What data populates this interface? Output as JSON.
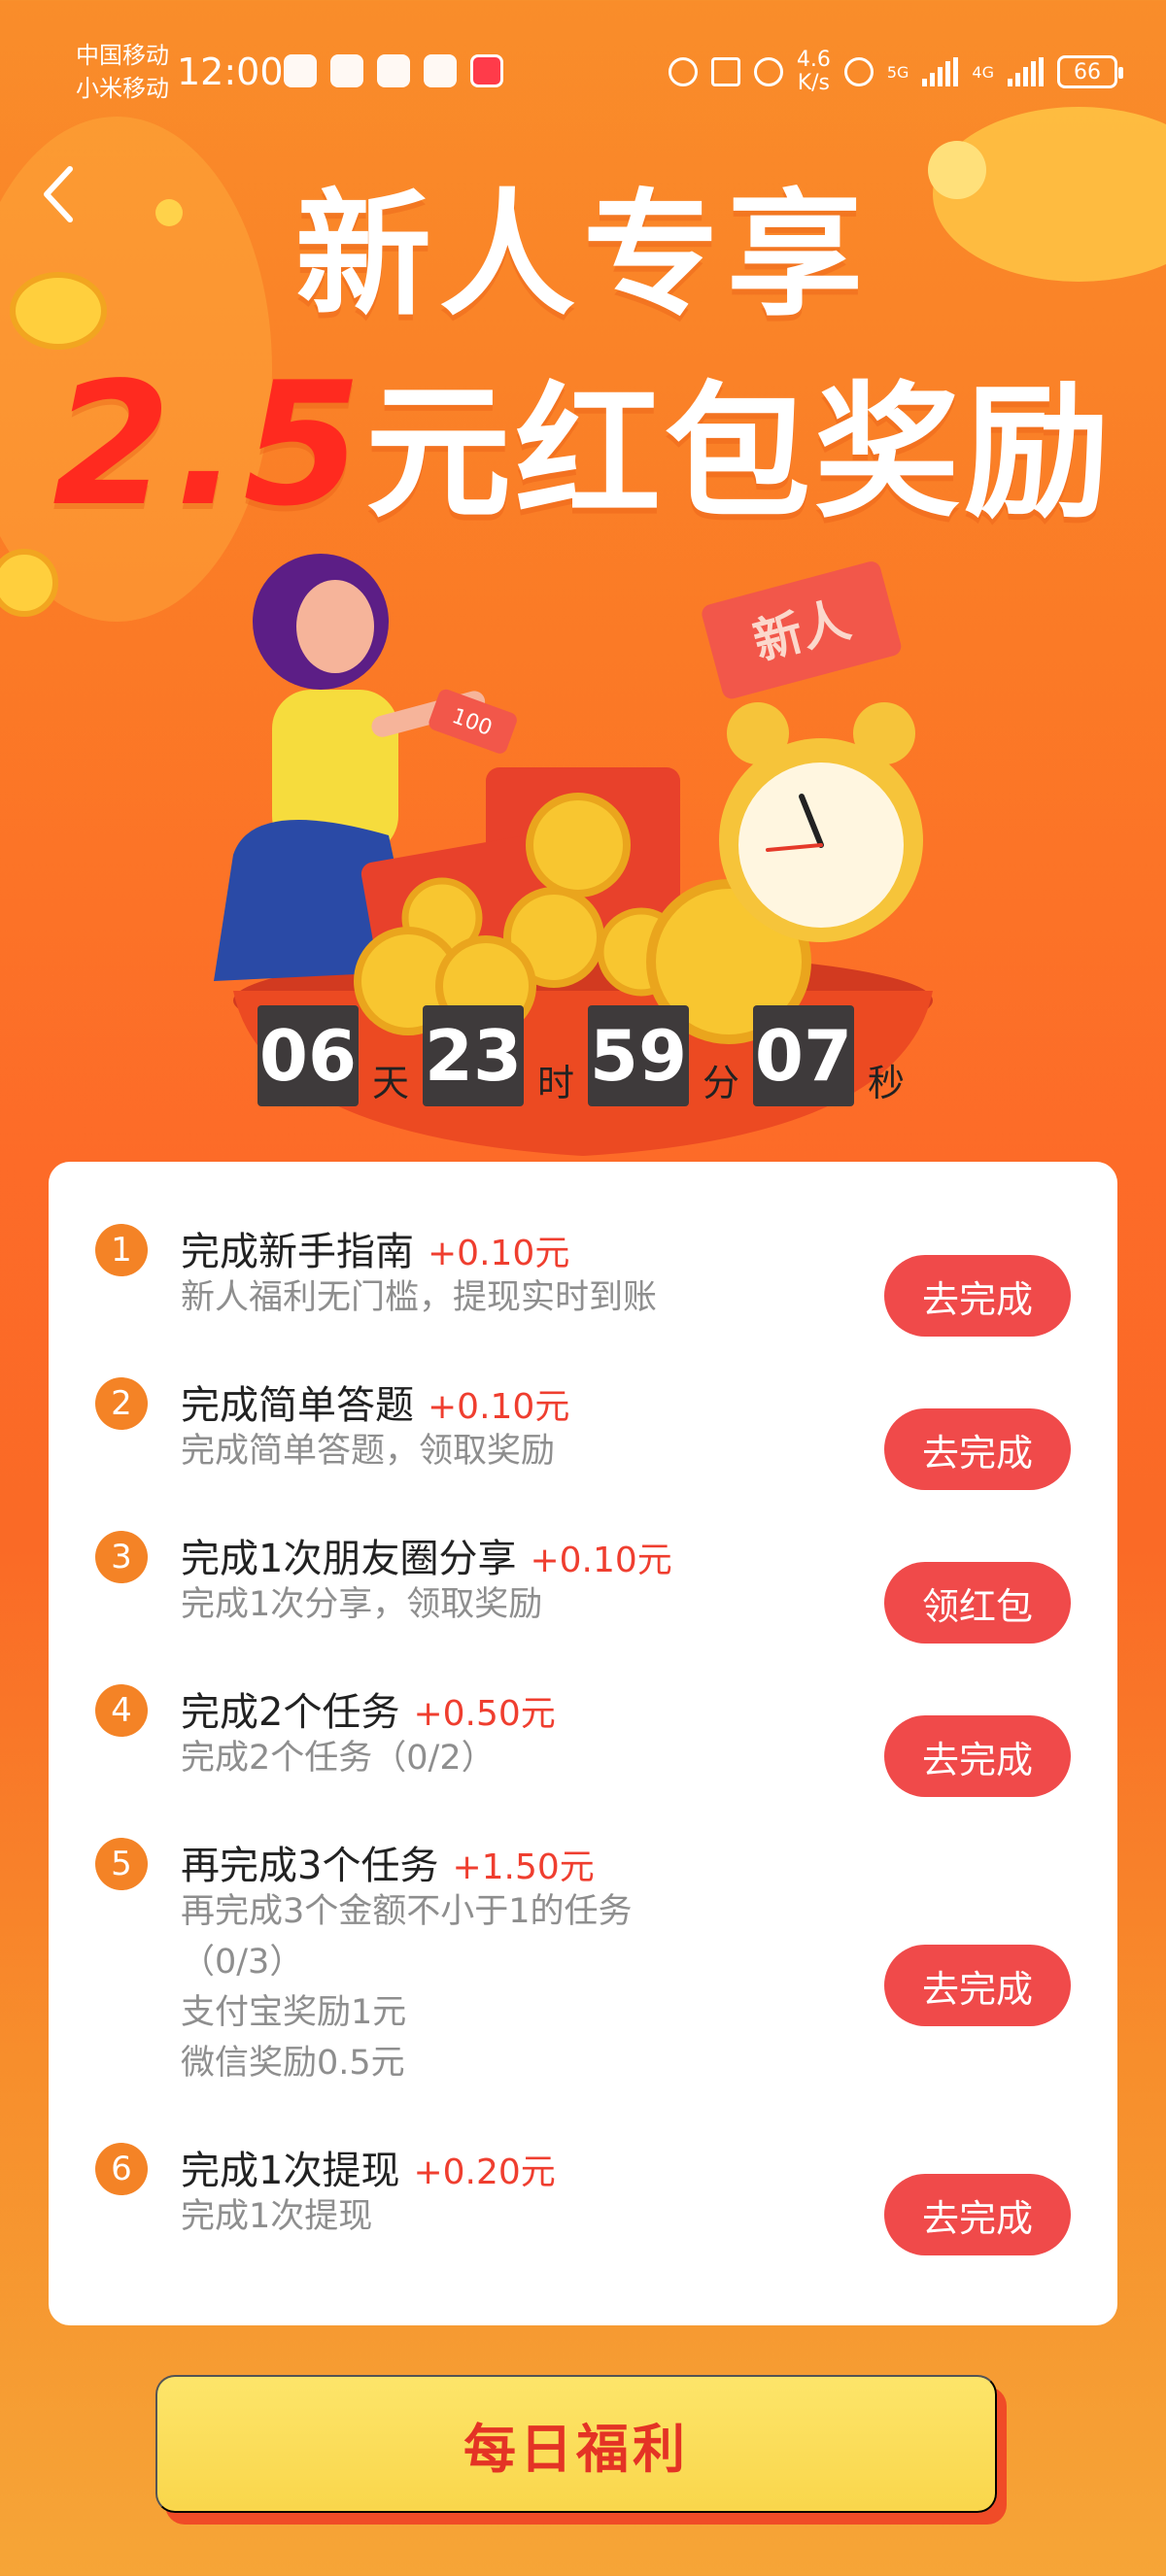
{
  "status_bar": {
    "carrier1": "中国移动",
    "carrier2": "小米移动",
    "time": "12:00",
    "speed_value": "4.6",
    "speed_unit": "K/s",
    "net1": "5G",
    "net2": "4G",
    "battery": "66"
  },
  "header": {
    "title_line1": "新人专享",
    "amount": "2.5",
    "title_line2_suffix": "元红包奖励",
    "illustration_badge": "新人",
    "illustration_note": "100"
  },
  "countdown": {
    "days": "06",
    "days_unit": "天",
    "hours": "23",
    "hours_unit": "时",
    "minutes": "59",
    "minutes_unit": "分",
    "seconds": "07",
    "seconds_unit": "秒"
  },
  "tasks": [
    {
      "num": "1",
      "title": "完成新手指南",
      "reward": "+0.10元",
      "desc": [
        "新人福利无门槛，提现实时到账"
      ],
      "button": "去完成"
    },
    {
      "num": "2",
      "title": "完成简单答题",
      "reward": "+0.10元",
      "desc": [
        "完成简单答题，领取奖励"
      ],
      "button": "去完成"
    },
    {
      "num": "3",
      "title": "完成1次朋友圈分享",
      "reward": "+0.10元",
      "desc": [
        "完成1次分享，领取奖励"
      ],
      "button": "领红包"
    },
    {
      "num": "4",
      "title": "完成2个任务",
      "reward": "+0.50元",
      "desc": [
        "完成2个任务（0/2）"
      ],
      "button": "去完成"
    },
    {
      "num": "5",
      "title": "再完成3个任务",
      "reward": "+1.50元",
      "desc": [
        "再完成3个金额不小于1的任务",
        "（0/3）",
        "支付宝奖励1元",
        "微信奖励0.5元"
      ],
      "button": "去完成"
    },
    {
      "num": "6",
      "title": "完成1次提现",
      "reward": "+0.20元",
      "desc": [
        "完成1次提现"
      ],
      "button": "去完成"
    }
  ],
  "footer": {
    "daily_button": "每日福利"
  },
  "colors": {
    "accent_red": "#f04a4a",
    "number_orange": "#f48326",
    "reward_red": "#ef3e2f"
  }
}
